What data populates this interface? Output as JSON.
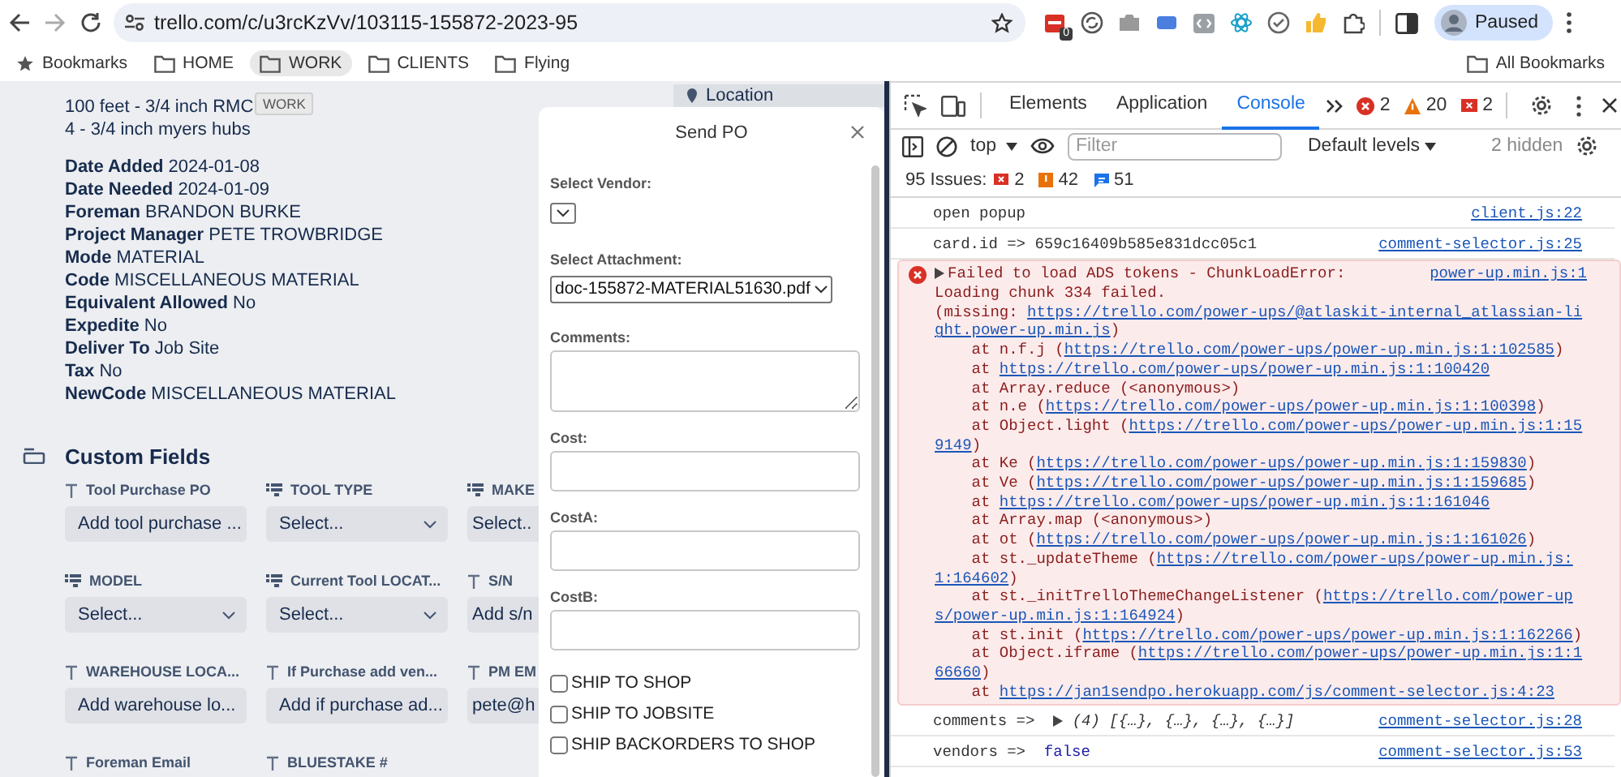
{
  "browser": {
    "url": "trello.com/c/u3rcKzVv/103115-155872-2023-95",
    "extension_badge": "0",
    "profile": "Paused"
  },
  "bookmarks": [
    {
      "kind": "star",
      "label": "Bookmarks",
      "highlighted": false
    },
    {
      "kind": "folder",
      "label": "HOME",
      "highlighted": false
    },
    {
      "kind": "folder",
      "label": "WORK",
      "highlighted": true
    },
    {
      "kind": "folder",
      "label": "CLIENTS",
      "highlighted": false
    },
    {
      "kind": "folder",
      "label": "Flying",
      "highlighted": false
    }
  ],
  "all_bookmarks": "All Bookmarks",
  "tooltip": "WORK",
  "card": {
    "description_lines": [
      "100 feet - 3/4 inch RMC",
      "4 - 3/4 inch myers hubs"
    ],
    "fields": [
      "**Date Added** 2024-01-08",
      "**Date Needed** 2024-01-09",
      "**Foreman** BRANDON BURKE",
      "**Project Manager** PETE TROWBRIDGE",
      "**Mode** MATERIAL",
      "**Code** MISCELLANEOUS MATERIAL",
      "**Equivalent Allowed** No",
      "**Expedite** No",
      "**Deliver To** Job Site",
      "**Tax** No",
      "**NewCode** MISCELLANEOUS MATERIAL"
    ]
  },
  "custom_fields": {
    "title": "Custom Fields",
    "fields": [
      {
        "kind": "text",
        "label": "Tool Purchase PO",
        "value": "Add tool purchase ..."
      },
      {
        "kind": "select",
        "label": "TOOL TYPE",
        "value": "Select..."
      },
      {
        "kind": "select",
        "label": "MAKE",
        "value": "Select.."
      },
      {
        "kind": "select",
        "label": "MODEL",
        "value": "Select..."
      },
      {
        "kind": "select",
        "label": "Current Tool LOCAT...",
        "value": "Select..."
      },
      {
        "kind": "text",
        "label": "S/N",
        "value": "Add s/n"
      },
      {
        "kind": "text",
        "label": "WAREHOUSE LOCA...",
        "value": "Add warehouse lo..."
      },
      {
        "kind": "text",
        "label": "If Purchase add ven...",
        "value": "Add if purchase ad..."
      },
      {
        "kind": "text",
        "label": "PM EM",
        "value": "pete@h"
      },
      {
        "kind": "text",
        "label": "Foreman Email"
      },
      {
        "kind": "text",
        "label": "BLUESTAKE #"
      }
    ]
  },
  "location_button": "Location",
  "modal": {
    "title": "Send PO",
    "fields": [
      {
        "kind": "select",
        "label": "Select Vendor:"
      },
      {
        "kind": "select",
        "label": "Select Attachment:",
        "value": "doc-155872-MATERIAL51630.pdf"
      },
      {
        "kind": "textarea",
        "label": "Comments:"
      },
      {
        "kind": "input",
        "label": "Cost:"
      },
      {
        "kind": "input",
        "label": "CostA:"
      },
      {
        "kind": "input",
        "label": "CostB:"
      }
    ],
    "checkboxes": [
      {
        "label": "SHIP TO SHOP",
        "checked": false
      },
      {
        "label": "SHIP TO JOBSITE",
        "checked": false
      },
      {
        "label": "SHIP BACKORDERS TO SHOP",
        "checked": false
      }
    ]
  },
  "devtools": {
    "tabs": [
      {
        "label": "Elements",
        "selected": false
      },
      {
        "label": "Application",
        "selected": false
      },
      {
        "label": "Console",
        "selected": true
      }
    ],
    "counts": [
      {
        "kind": "error",
        "count": "2"
      },
      {
        "kind": "warning",
        "count": "20"
      },
      {
        "kind": "issue",
        "count": "2"
      }
    ],
    "context": "top",
    "filter_placeholder": "Filter",
    "levels": "Default levels",
    "hidden": "2 hidden",
    "issues": {
      "label": "95 Issues:",
      "counts": [
        {
          "kind": "error",
          "count": "2"
        },
        {
          "kind": "warning",
          "count": "42"
        },
        {
          "kind": "info",
          "count": "51"
        }
      ]
    },
    "messages": [
      {
        "kind": "log",
        "text": "open popup",
        "source": "client.js:22"
      },
      {
        "kind": "log",
        "text": "card.id =>  659c16409b585e831dcc05c1",
        "source": "comment-selector.js:25"
      },
      {
        "kind": "error",
        "summary": "Failed to load ADS tokens - ChunkLoadError:",
        "source": "power-up.min.js:1",
        "lines": [
          {
            "pre": "Loading chunk 334 failed."
          },
          {
            "pre": "(missing: ",
            "link": "https://trello.com/power-ups/@atlaskit-internal_atlassian-li"
          },
          {
            "link": "ght.power-up.min.js",
            "post": ")"
          },
          {
            "pre": "    at n.f.j (",
            "link": "https://trello.com/power-ups/power-up.min.js:1:102585",
            "post": ")"
          },
          {
            "pre": "    at ",
            "link": "https://trello.com/power-ups/power-up.min.js:1:100420"
          },
          {
            "pre": "    at Array.reduce (<anonymous>)"
          },
          {
            "pre": "    at n.e (",
            "link": "https://trello.com/power-ups/power-up.min.js:1:100398",
            "post": ")"
          },
          {
            "pre": "    at Object.light (",
            "link": "https://trello.com/power-ups/power-up.min.js:1:15"
          },
          {
            "link": "9149",
            "post": ")"
          },
          {
            "pre": "    at Ke (",
            "link": "https://trello.com/power-ups/power-up.min.js:1:159830",
            "post": ")"
          },
          {
            "pre": "    at Ve (",
            "link": "https://trello.com/power-ups/power-up.min.js:1:159685",
            "post": ")"
          },
          {
            "pre": "    at ",
            "link": "https://trello.com/power-ups/power-up.min.js:1:161046"
          },
          {
            "pre": "    at Array.map (<anonymous>)"
          },
          {
            "pre": "    at ot (",
            "link": "https://trello.com/power-ups/power-up.min.js:1:161026",
            "post": ")"
          },
          {
            "pre": "    at st._updateTheme (",
            "link": "https://trello.com/power-ups/power-up.min.js:"
          },
          {
            "link": "1:164602",
            "post": ")"
          },
          {
            "pre": "    at st._initTrelloThemeChangeListener (",
            "link": "https://trello.com/power-up"
          },
          {
            "link": "s/power-up.min.js:1:164924",
            "post": ")"
          },
          {
            "pre": "    at st.init (",
            "link": "https://trello.com/power-ups/power-up.min.js:1:162266",
            "post": ")"
          },
          {
            "pre": "    at Object.iframe (",
            "link": "https://trello.com/power-ups/power-up.min.js:1:1"
          },
          {
            "link": "66660",
            "post": ")"
          },
          {
            "pre": "    at ",
            "link": "https://jan1sendpo.herokuapp.com/js/comment-selector.js:4:23"
          }
        ]
      },
      {
        "kind": "object",
        "label": "comments =>",
        "value": "(4) [{…}, {…}, {…}, {…}]",
        "source": "comment-selector.js:28"
      },
      {
        "kind": "value",
        "label": "vendors =>",
        "value": "false",
        "source": "comment-selector.js:53"
      }
    ]
  }
}
